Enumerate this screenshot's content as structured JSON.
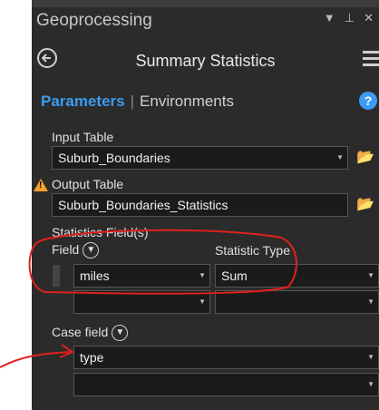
{
  "pane": {
    "title": "Geoprocessing"
  },
  "tool": {
    "title": "Summary Statistics"
  },
  "tabs": {
    "parameters": "Parameters",
    "environments": "Environments"
  },
  "help": {
    "glyph": "?"
  },
  "input_table": {
    "label": "Input Table",
    "value": "Suburb_Boundaries"
  },
  "output_table": {
    "label": "Output Table",
    "value": "Suburb_Boundaries_Statistics"
  },
  "statistics_fields": {
    "label": "Statistics Field(s)",
    "field_header": "Field",
    "statistic_header": "Statistic Type",
    "rows": [
      {
        "field": "miles",
        "statistic": "Sum"
      },
      {
        "field": "",
        "statistic": ""
      }
    ]
  },
  "case_field": {
    "label": "Case field",
    "rows": [
      {
        "value": "type"
      },
      {
        "value": ""
      }
    ]
  },
  "colors": {
    "accent": "#3c9cf2",
    "annotation": "#e0201c",
    "warning": "#f0a22b",
    "folder": "#e7b64c"
  }
}
